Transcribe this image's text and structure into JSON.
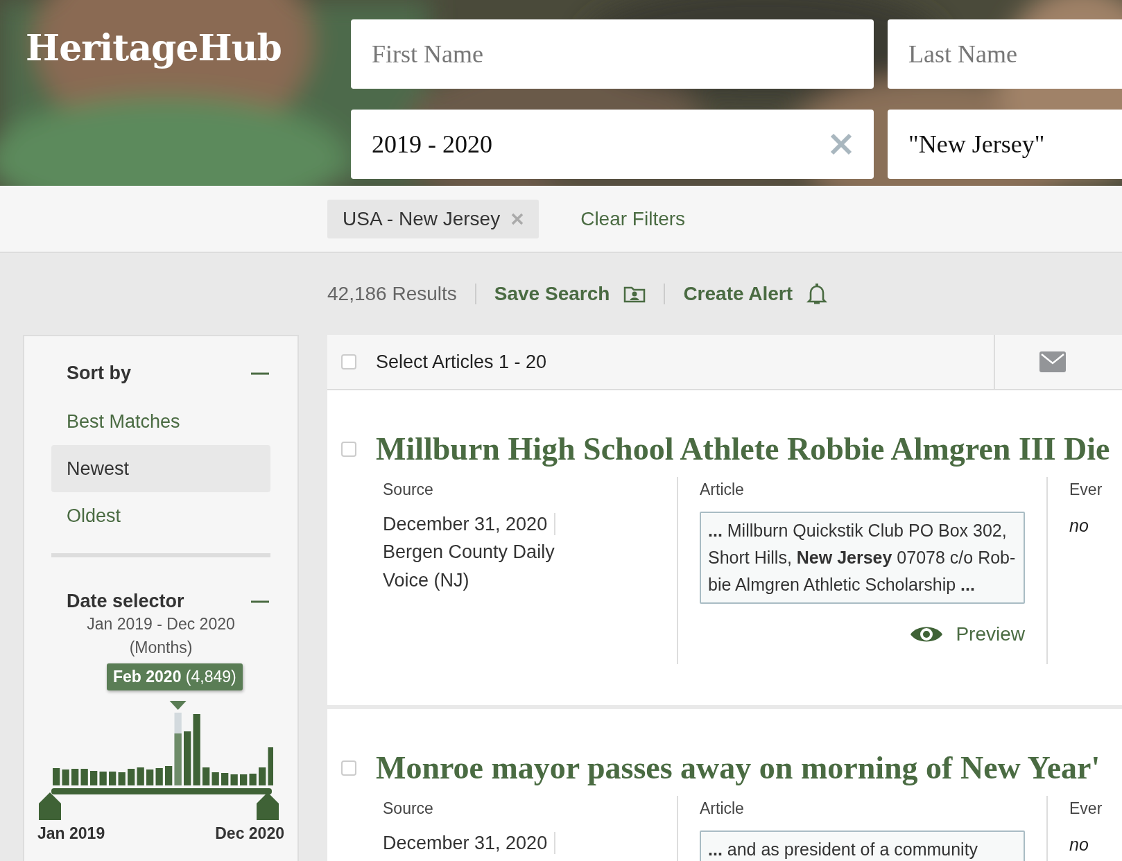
{
  "logo": "HeritageHub",
  "search_fields": [
    {
      "placeholder": "First Name"
    },
    {
      "placeholder": "Last Name"
    },
    {
      "value": "2019 - 2020",
      "clearable": true
    },
    {
      "value": "\"New Jersey\"",
      "clearable": false
    }
  ],
  "filters": {
    "chips": [
      {
        "label": "USA - New Jersey"
      }
    ],
    "clear": "Clear Filters"
  },
  "results_bar": {
    "count": "42,186 Results",
    "save_search": "Save Search",
    "create_alert": "Create Alert"
  },
  "sidebar": {
    "sort": {
      "title": "Sort by",
      "expanded": true,
      "options": [
        {
          "label": "Best Matches",
          "selected": false
        },
        {
          "label": "Newest",
          "selected": true
        },
        {
          "label": "Oldest",
          "selected": false
        }
      ]
    },
    "date_selector": {
      "title": "Date selector",
      "expanded": true,
      "range": "Jan 2019 - Dec 2020",
      "unit": "(Months)",
      "tooltip": "**Feb 2020** (4,849)",
      "start_label": "Jan 2019",
      "end_label": "Dec 2020"
    }
  },
  "results": {
    "select_all": {
      "label": "Select Articles 1 - 20",
      "checked": false
    },
    "articles": [
      {
        "title": "Millburn High School Athlete Robbie Almgren III Die",
        "checked": false,
        "source_heading": "Source",
        "date": "December 31, 2020",
        "source": "Bergen County Daily Voice (NJ)",
        "article_heading": "Article",
        "snippet": "**...** Millburn Quickstik Club PO Box 302, Short Hills, **New Jersey** 07078 c/o Rob-bie Almgren Athletic Scholarship **...**",
        "preview": "Preview",
        "event_heading": "Ever",
        "event": "no"
      },
      {
        "title": "Monroe mayor passes away on morning of New Year'",
        "checked": false,
        "source_heading": "Source",
        "date": "December 31, 2020",
        "article_heading": "Article",
        "snippet": "**...** and as president of a community",
        "event_heading": "Ever",
        "event": "no"
      }
    ]
  }
}
